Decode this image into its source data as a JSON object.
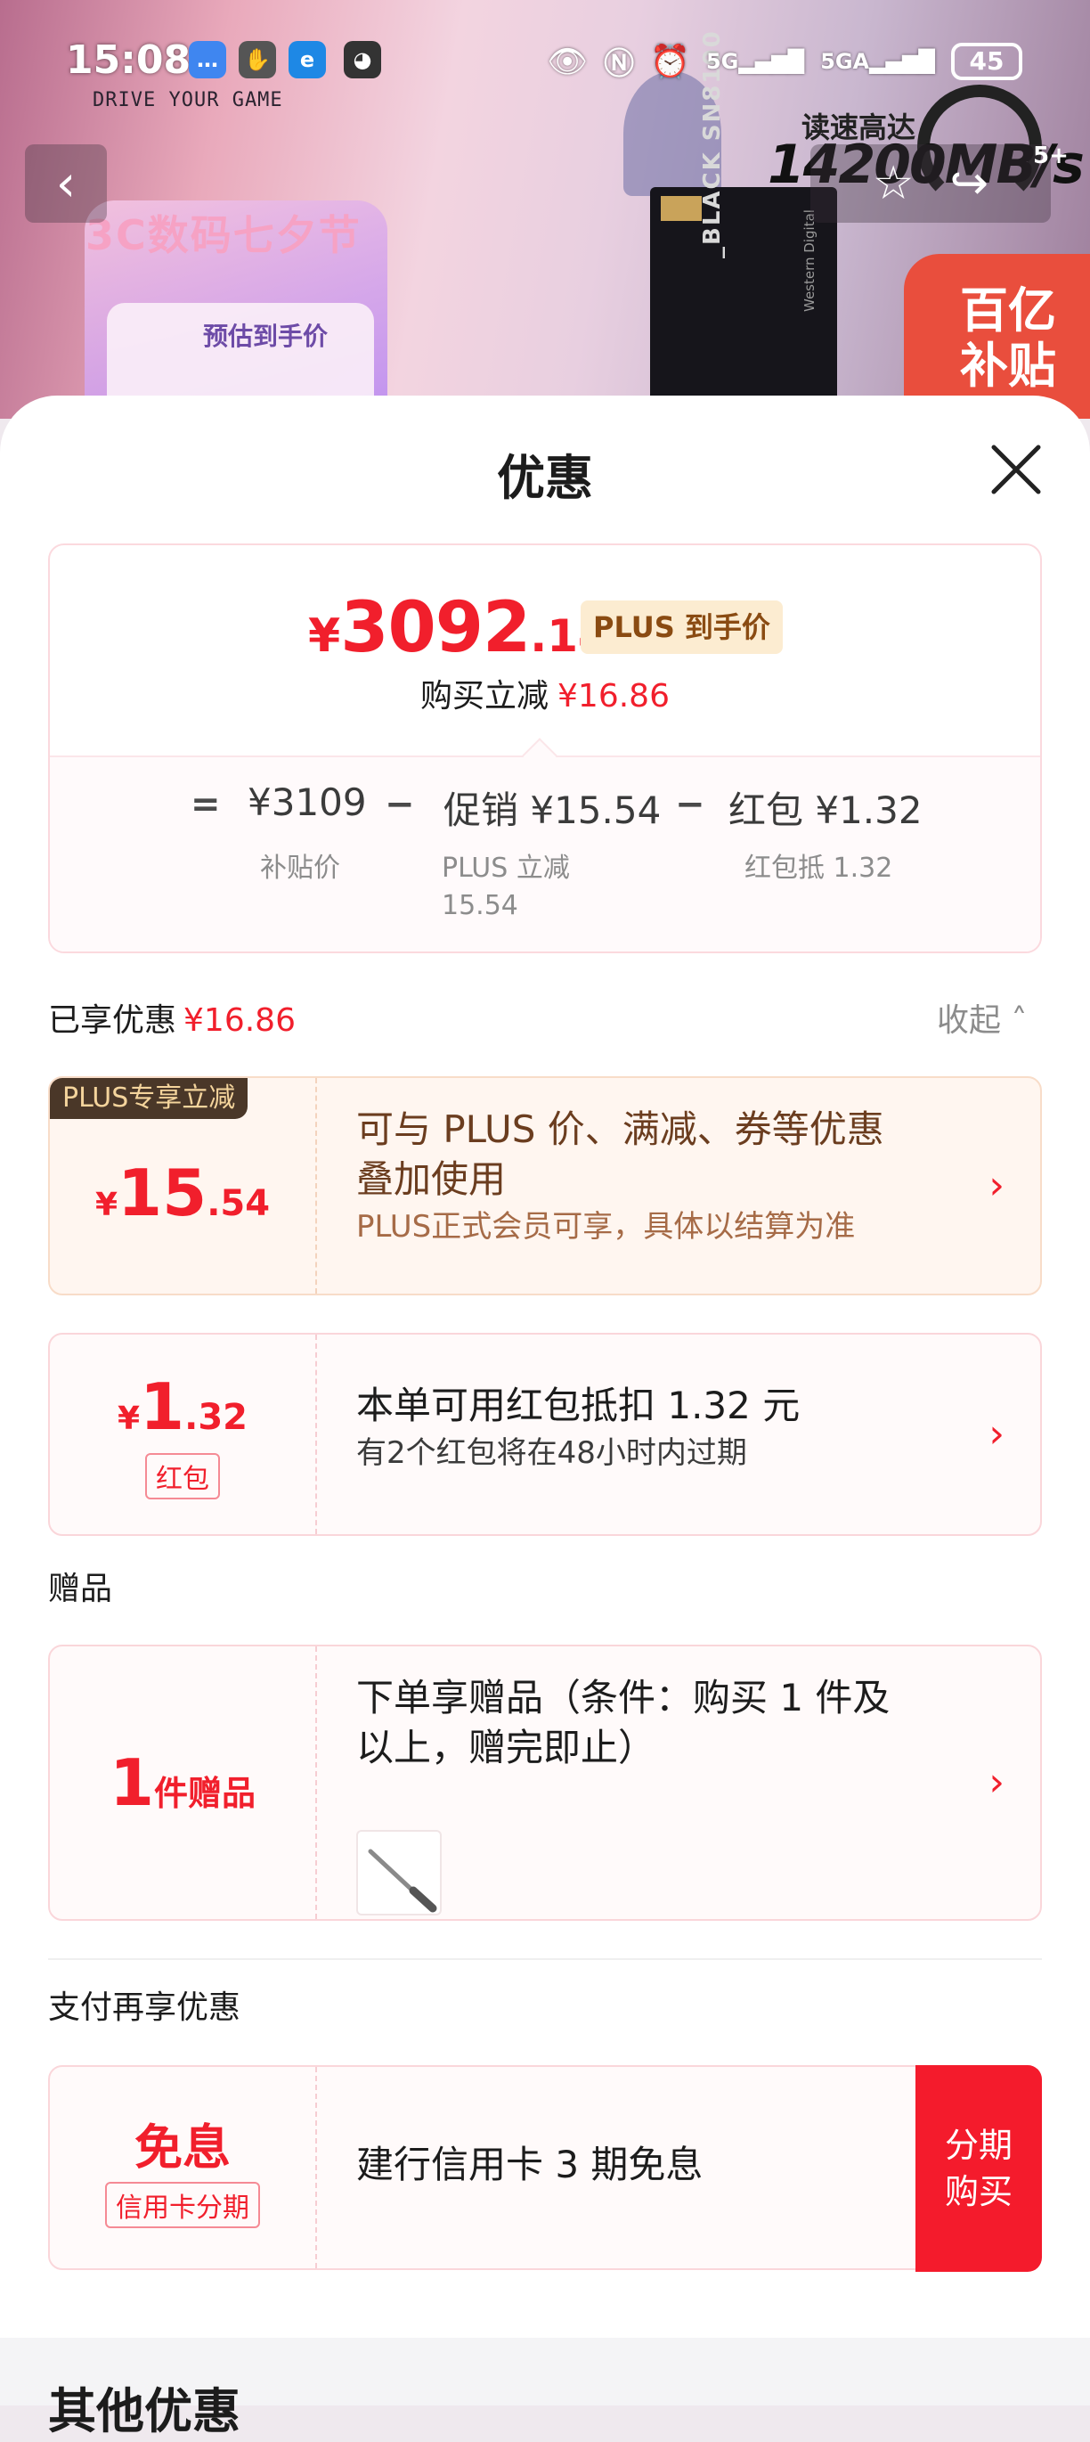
{
  "status_bar": {
    "time": "15:08",
    "network_1": "5G",
    "network_2": "5GA",
    "battery": "45",
    "icons": [
      "chat-icon",
      "hand-icon",
      "browser-icon",
      "mask-icon",
      "eye-icon",
      "nfc-icon",
      "alarm-icon"
    ]
  },
  "banner": {
    "tagline": "DRIVE YOUR GAME",
    "festival": "3C数码七夕节",
    "estimate_label": "预估到手价",
    "ssd_model": "SN8100",
    "ssd_brand": "_BLACK",
    "ssd_maker": "Western Digital",
    "speed_label": "读速高达",
    "speed_value": "14200MB/s",
    "badge": "百亿补贴",
    "count_badge": "5+"
  },
  "sheet": {
    "title": "优惠",
    "summary": {
      "final_currency": "¥",
      "final_int": "3092",
      "final_dec": ".14",
      "plus_tag": "PLUS 到手价",
      "reduce_label": "购买立减",
      "reduce_amount": "¥16.86",
      "equation": {
        "eq": "=",
        "minus": "−",
        "subsidy_value": "¥3109",
        "subsidy_label": "补贴价",
        "promo_value": "促销 ¥15.54",
        "promo_label_1": "PLUS 立减",
        "promo_label_2": "15.54",
        "redpacket_value": "红包 ¥1.32",
        "redpacket_label": "红包抵 1.32"
      }
    },
    "enjoyed": {
      "label": "已享优惠",
      "amount": "¥16.86",
      "collapse": "收起"
    },
    "plus_card": {
      "corner": "PLUS专享立减",
      "currency": "¥",
      "int": "15",
      "dec": ".54",
      "title_1": "可与 PLUS 价、满减、券等优惠",
      "title_2": "叠加使用",
      "sub": "PLUS正式会员可享，具体以结算为准"
    },
    "redpacket_card": {
      "currency": "¥",
      "int": "1",
      "dec": ".32",
      "tag": "红包",
      "title": "本单可用红包抵扣 1.32 元",
      "sub": "有2个红包将在48小时内过期"
    },
    "gift_section": "赠品",
    "gift_card": {
      "count": "1",
      "unit": "件赠品",
      "title_1": "下单享赠品（条件：购买 1 件及",
      "title_2": "以上，赠完即止）"
    },
    "payment_section": "支付再享优惠",
    "payment_card": {
      "big": "免息",
      "tag": "信用卡分期",
      "title": "建行信用卡 3 期免息",
      "btn_line1": "分期",
      "btn_line2": "购买"
    },
    "other_section": "其他优惠"
  },
  "colors": {
    "accent_red": "#f11f2c",
    "plus_brown": "#8a4b12",
    "card_border": "#fad6da"
  }
}
